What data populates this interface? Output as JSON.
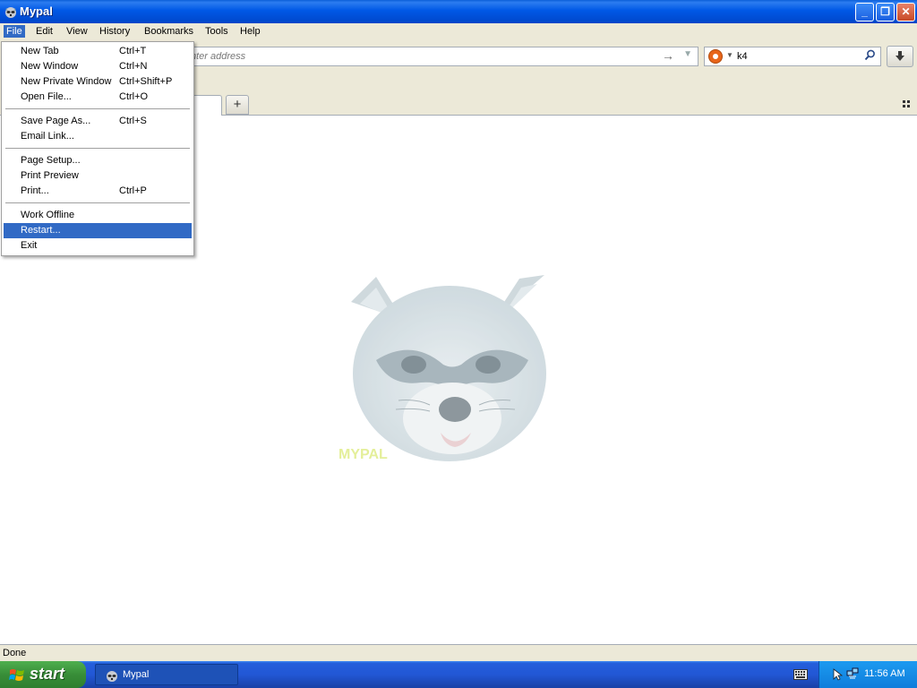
{
  "window": {
    "title": "Mypal",
    "minimize_glyph": "_",
    "maximize_glyph": "❐",
    "close_glyph": "✕"
  },
  "menubar": {
    "items": [
      "File",
      "Edit",
      "View",
      "History",
      "Bookmarks",
      "Tools",
      "Help"
    ]
  },
  "navbar": {
    "url_placeholder": "nter address",
    "go_glyph": "→",
    "search_value": "k4",
    "search_glyph": "⚲",
    "download_glyph": "⬇"
  },
  "tabbar": {
    "new_tab_glyph": "+"
  },
  "content": {
    "wordmark": "MYPAL"
  },
  "file_menu": {
    "items": [
      {
        "label": "New Tab",
        "shortcut": "Ctrl+T"
      },
      {
        "label": "New Window",
        "shortcut": "Ctrl+N"
      },
      {
        "label": "New Private Window",
        "shortcut": "Ctrl+Shift+P"
      },
      {
        "label": "Open File...",
        "shortcut": "Ctrl+O"
      },
      {
        "label": "Save Page As...",
        "shortcut": "Ctrl+S"
      },
      {
        "label": "Email Link...",
        "shortcut": ""
      },
      {
        "label": "Page Setup...",
        "shortcut": ""
      },
      {
        "label": "Print Preview",
        "shortcut": ""
      },
      {
        "label": "Print...",
        "shortcut": "Ctrl+P"
      },
      {
        "label": "Work Offline",
        "shortcut": ""
      },
      {
        "label": "Restart...",
        "shortcut": ""
      },
      {
        "label": "Exit",
        "shortcut": ""
      }
    ],
    "highlighted": "Restart..."
  },
  "statusbar": {
    "text": "Done"
  },
  "taskbar": {
    "start_label": "start",
    "task_label": "Mypal",
    "clock": "11:56 AM"
  },
  "colors": {
    "menu_highlight": "#316AC5",
    "titlebar_blue": "#0058E6",
    "start_green": "#388E38"
  }
}
